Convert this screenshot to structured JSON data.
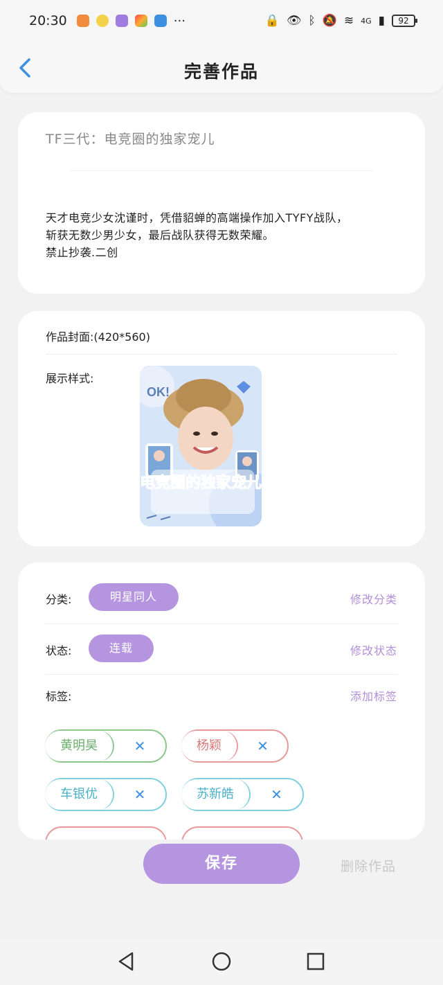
{
  "status_bar": {
    "time": "20:30",
    "more": "···",
    "network": "4G",
    "battery": "92"
  },
  "header": {
    "title": "完善作品"
  },
  "work": {
    "title": "TF三代：电竞圈的独家宠儿",
    "synopsis_lines": [
      "天才电竞少女沈谨时，凭借貂蝉的高端操作加入TYFY战队，",
      "斩获无数少男少女，最后战队获得无数荣耀。",
      "禁止抄袭.二创"
    ]
  },
  "cover": {
    "label": "作品封面:(420*560)",
    "display_label": "展示样式:",
    "image_text": "电竞圈的独家宠儿",
    "badge_text": "OK!"
  },
  "category": {
    "label": "分类:",
    "value": "明星同人",
    "action": "修改分类"
  },
  "status": {
    "label": "状态:",
    "value": "连载",
    "action": "修改状态"
  },
  "tags": {
    "label": "标签:",
    "action": "添加标签",
    "items": [
      {
        "name": "黄明昊",
        "remove": "✕"
      },
      {
        "name": "杨颖",
        "remove": "✕"
      },
      {
        "name": "车银优",
        "remove": "✕"
      },
      {
        "name": "苏新皓",
        "remove": "✕"
      }
    ]
  },
  "footer": {
    "save": "保存",
    "delete": "删除作品"
  },
  "colors": {
    "accent": "#b695e0",
    "back_icon": "#3d8fe0"
  }
}
